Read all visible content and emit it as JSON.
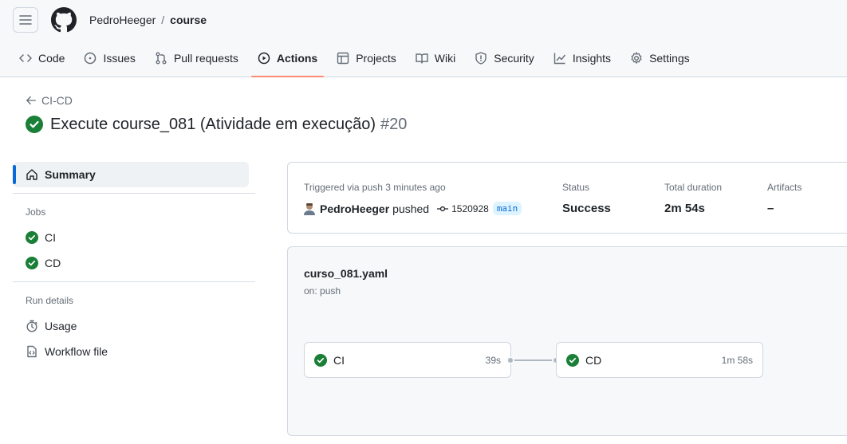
{
  "repo": {
    "owner": "PedroHeeger",
    "separator": "/",
    "name": "course"
  },
  "tabs": [
    {
      "label": "Code",
      "icon": "code-icon"
    },
    {
      "label": "Issues",
      "icon": "issue-icon"
    },
    {
      "label": "Pull requests",
      "icon": "pull-request-icon"
    },
    {
      "label": "Actions",
      "icon": "play-icon",
      "active": true
    },
    {
      "label": "Projects",
      "icon": "table-icon"
    },
    {
      "label": "Wiki",
      "icon": "book-icon"
    },
    {
      "label": "Security",
      "icon": "shield-icon"
    },
    {
      "label": "Insights",
      "icon": "graph-icon"
    },
    {
      "label": "Settings",
      "icon": "gear-icon"
    }
  ],
  "back_link": "CI-CD",
  "run": {
    "title": "Execute course_081 (Atividade em execução)",
    "number": "#20"
  },
  "sidebar": {
    "summary": "Summary",
    "jobs_heading": "Jobs",
    "jobs": [
      "CI",
      "CD"
    ],
    "run_details_heading": "Run details",
    "usage": "Usage",
    "workflow_file": "Workflow file"
  },
  "summary": {
    "trigger_label": "Triggered via push 3 minutes ago",
    "actor": "PedroHeeger",
    "action": "pushed",
    "commit": "1520928",
    "branch": "main",
    "status_label": "Status",
    "status_value": "Success",
    "duration_label": "Total duration",
    "duration_value": "2m 54s",
    "artifacts_label": "Artifacts",
    "artifacts_value": "–"
  },
  "workflow": {
    "file": "curso_081.yaml",
    "trigger": "on: push",
    "jobs": [
      {
        "name": "CI",
        "duration": "39s"
      },
      {
        "name": "CD",
        "duration": "1m 58s"
      }
    ]
  },
  "colors": {
    "success": "#1a7f37",
    "accent": "#0969da",
    "active_tab": "#fd8c73"
  }
}
